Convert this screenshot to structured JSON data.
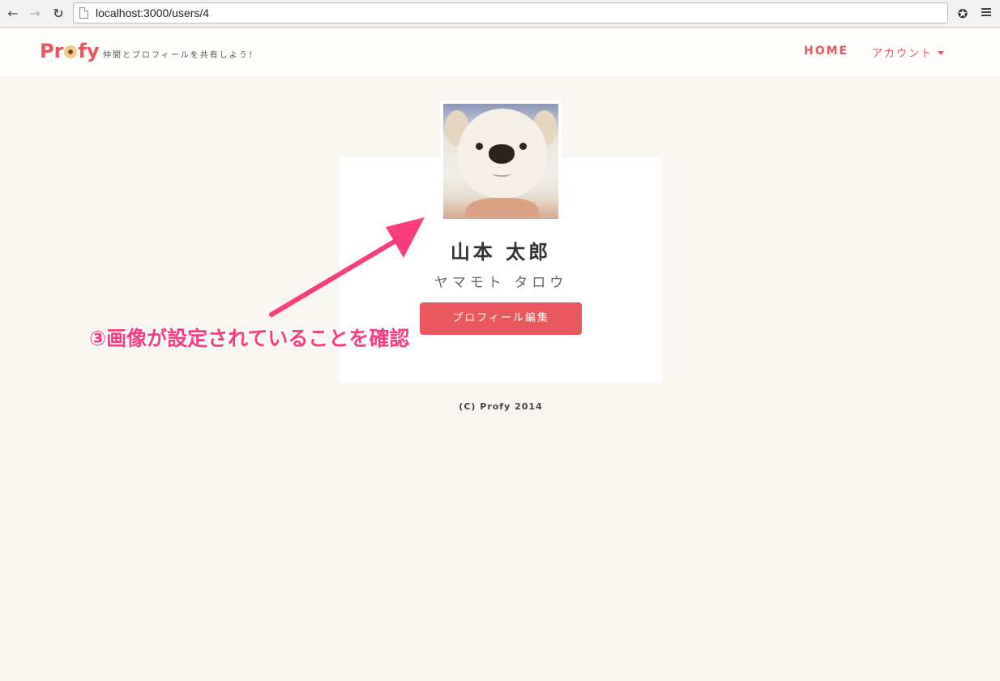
{
  "browser": {
    "url": "localhost:3000/users/4",
    "back_icon": "←",
    "forward_icon": "→",
    "reload_icon": "↻",
    "extension_icon": "✪"
  },
  "site": {
    "logo_pre": "Pr",
    "logo_post": "fy",
    "tagline": "仲間とプロフィールを共有しよう！",
    "nav": {
      "home": "HOME",
      "account": "アカウント"
    },
    "brand_color": "#e8555b"
  },
  "profile": {
    "name": "山本 太郎",
    "kana": "ヤマモト タロウ",
    "edit_button": "プロフィール編集"
  },
  "footer": {
    "copyright": "(C) Profy 2014"
  },
  "annotation": {
    "text": "③画像が設定されていることを確認",
    "color": "#fb3c7d"
  }
}
